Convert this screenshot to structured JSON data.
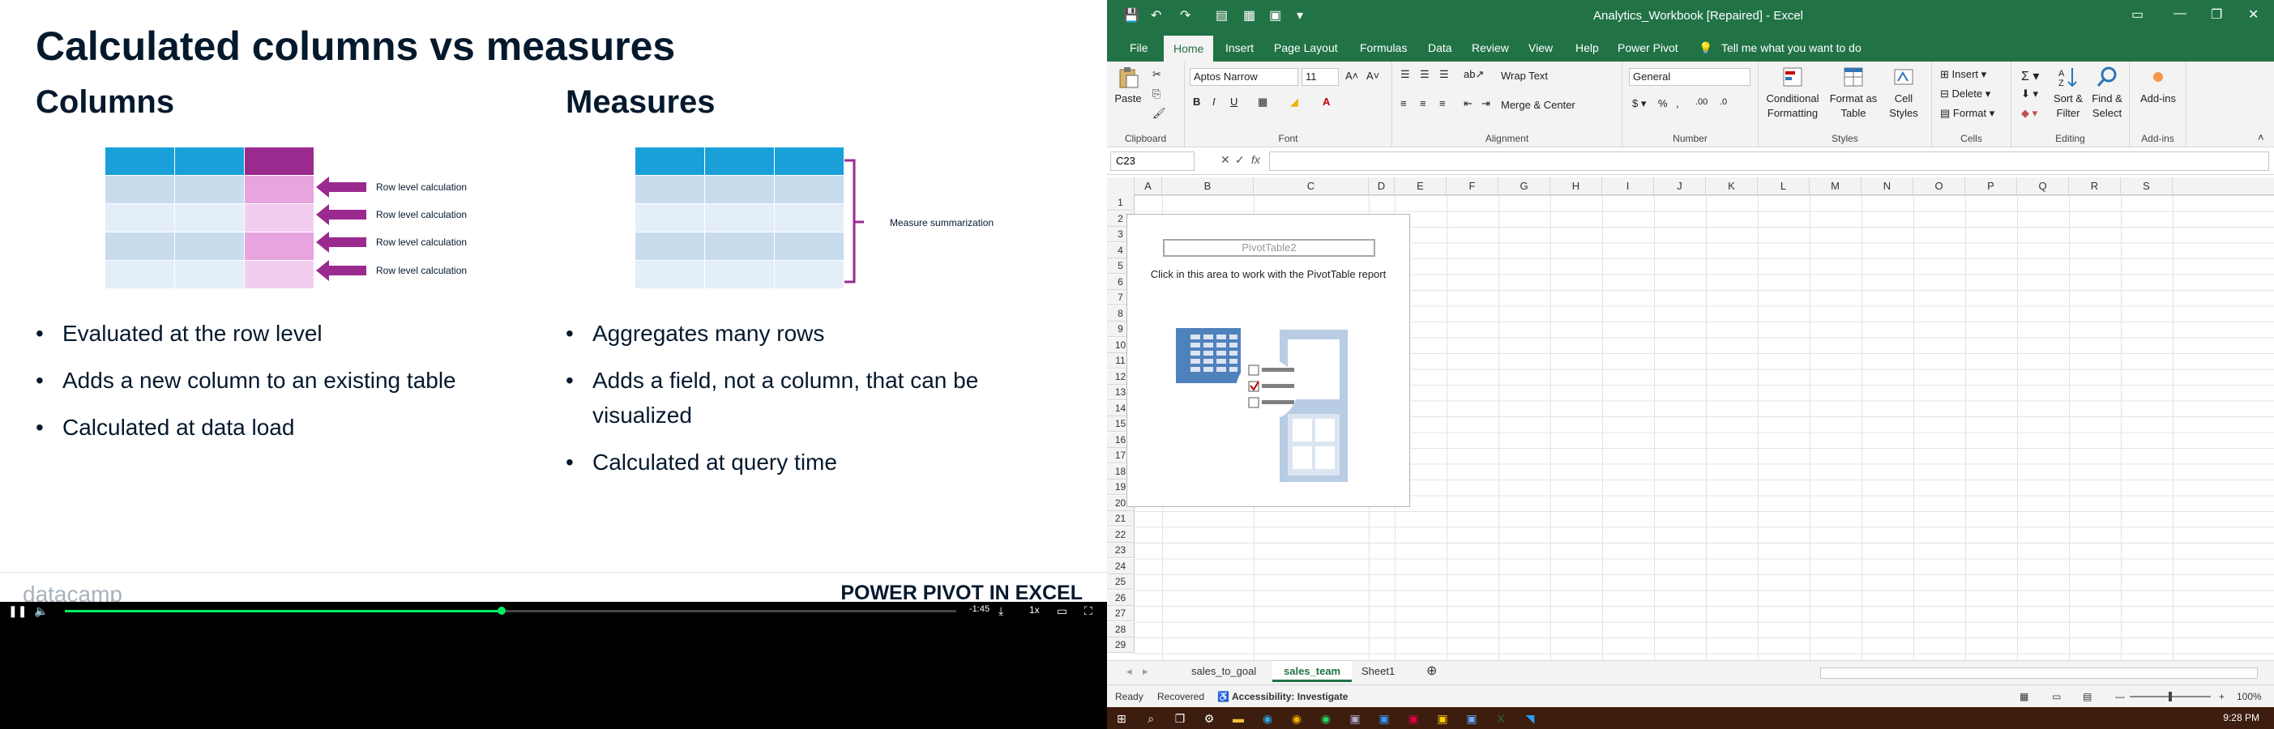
{
  "slide": {
    "title": "Calculated columns vs measures",
    "columns_heading": "Columns",
    "measures_heading": "Measures",
    "row_labels": [
      "Row level calculation",
      "Row level calculation",
      "Row level calculation",
      "Row level calculation"
    ],
    "measure_label": "Measure summarization",
    "columns_bullets": [
      "Evaluated at the row level",
      "Adds a new column to an existing table",
      "Calculated at data load"
    ],
    "measures_bullets": [
      "Aggregates many rows",
      "Adds a field, not a column, that can be visualized",
      "Calculated at query time"
    ],
    "brand": "datacamp",
    "course": "POWER PIVOT IN EXCEL",
    "colors": {
      "header_blue": "#1aa0d8",
      "light_blue": "#c8dcee",
      "lighter_blue": "#e3eef8",
      "purple": "#9b2a8f",
      "pink": "#e7a4df",
      "light_pink": "#f3cdef"
    }
  },
  "player": {
    "time_remaining": "-1:45",
    "speed": "1x",
    "progress": 0.49
  },
  "excel": {
    "window_title": "Analytics_Workbook [Repaired] - Excel",
    "tabs": [
      "File",
      "Home",
      "Insert",
      "Page Layout",
      "Formulas",
      "Data",
      "Review",
      "View",
      "Help",
      "Power Pivot"
    ],
    "active_tab": "Home",
    "tell_me": "Tell me what you want to do",
    "clipboard": {
      "paste": "Paste",
      "label": "Clipboard"
    },
    "font": {
      "name": "Aptos Narrow",
      "size": "11",
      "label": "Font"
    },
    "alignment": {
      "wrap": "Wrap Text",
      "merge": "Merge & Center",
      "label": "Alignment"
    },
    "number": {
      "format": "General",
      "label": "Number"
    },
    "styles": {
      "conditional": "Conditional Formatting",
      "format_table": "Format as Table",
      "cell_styles": "Cell Styles",
      "label": "Styles"
    },
    "cells": {
      "insert": "Insert",
      "delete": "Delete",
      "format": "Format",
      "label": "Cells"
    },
    "editing": {
      "sort": "Sort & Filter",
      "find": "Find & Select",
      "label": "Editing"
    },
    "addins": {
      "button": "Add-ins",
      "label": "Add-ins"
    },
    "name_box": "C23",
    "columns": [
      "A",
      "B",
      "C",
      "D",
      "E",
      "F",
      "G",
      "H",
      "I",
      "J",
      "K",
      "L",
      "M",
      "N",
      "O",
      "P",
      "Q",
      "R",
      "S"
    ],
    "rows": [
      "1",
      "2",
      "3",
      "4",
      "5",
      "6",
      "7",
      "8",
      "9",
      "10",
      "11",
      "12",
      "13",
      "14",
      "15",
      "16",
      "17",
      "18",
      "19",
      "20",
      "21",
      "22",
      "23",
      "24",
      "25",
      "26",
      "27",
      "28",
      "29"
    ],
    "pivot_name": "PivotTable2",
    "pivot_hint": "Click in this area to work with the PivotTable report",
    "sheets": [
      "sales_to_goal",
      "sales_team",
      "Sheet1"
    ],
    "active_sheet": "sales_team",
    "status": {
      "ready": "Ready",
      "recovered": "Recovered",
      "accessibility": "Accessibility: Investigate",
      "zoom": "100%"
    }
  },
  "taskbar": {
    "time": "9:28 PM"
  }
}
